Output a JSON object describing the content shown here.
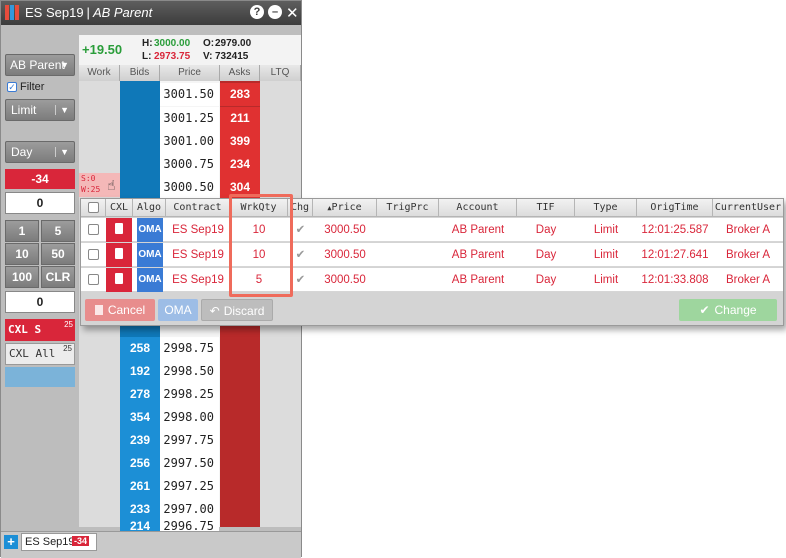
{
  "window": {
    "contract": "ES Sep19",
    "separator": "|",
    "account": "AB Parent"
  },
  "quote": {
    "change": "+19.50",
    "high_label": "H:",
    "high": "3000.00",
    "low_label": "L:",
    "low": "2973.75",
    "open_label": "O:",
    "open": "2979.00",
    "volume_label": "V:",
    "volume": "732415"
  },
  "ladder_headers": [
    "Work",
    "Bids",
    "Price",
    "Asks",
    "LTQ"
  ],
  "ladder_top": [
    {
      "price": "3001.50",
      "ask": "283"
    },
    {
      "price": "3001.25",
      "ask": "211"
    },
    {
      "price": "3001.00",
      "ask": "399"
    },
    {
      "price": "3000.75",
      "ask": "234"
    },
    {
      "price": "3000.50",
      "ask": "304"
    }
  ],
  "ladder_bottom": [
    {
      "bid": "258",
      "price": "2998.75"
    },
    {
      "bid": "192",
      "price": "2998.50"
    },
    {
      "bid": "278",
      "price": "2998.25"
    },
    {
      "bid": "354",
      "price": "2998.00"
    },
    {
      "bid": "239",
      "price": "2997.75"
    },
    {
      "bid": "256",
      "price": "2997.50"
    },
    {
      "bid": "261",
      "price": "2997.25"
    },
    {
      "bid": "233",
      "price": "2997.00"
    },
    {
      "bid": "214",
      "price": "2996.75"
    }
  ],
  "working_marker": {
    "s": "S:0",
    "w": "W:25"
  },
  "controls": {
    "account_select": "AB Parent",
    "filter_label": "Filter",
    "order_type": "Limit",
    "tif": "Day",
    "position": "-34",
    "quantity": "0",
    "qty_buttons": [
      "1",
      "5",
      "10",
      "50",
      "100",
      "CLR"
    ],
    "qty_field2": "0",
    "cxl_s_label": "CXL S",
    "cxl_s_count": "25",
    "cxl_all_label": "CXL All",
    "cxl_all_count": "25"
  },
  "popup": {
    "headers": [
      "CXL",
      "Algo",
      "Contract",
      "WrkQty",
      "Chg",
      "Price",
      "TrigPrc",
      "Account",
      "TIF",
      "Type",
      "OrigTime",
      "CurrentUser"
    ],
    "rows": [
      {
        "algo": "OMA",
        "contract": "ES Sep19",
        "wrkqty": "10",
        "price": "3000.50",
        "account": "AB Parent",
        "tif": "Day",
        "type": "Limit",
        "origtime": "12:01:25.587",
        "user": "Broker A"
      },
      {
        "algo": "OMA",
        "contract": "ES Sep19",
        "wrkqty": "10",
        "price": "3000.50",
        "account": "AB Parent",
        "tif": "Day",
        "type": "Limit",
        "origtime": "12:01:27.641",
        "user": "Broker A"
      },
      {
        "algo": "OMA",
        "contract": "ES Sep19",
        "wrkqty": "5",
        "price": "3000.50",
        "account": "AB Parent",
        "tif": "Day",
        "type": "Limit",
        "origtime": "12:01:33.808",
        "user": "Broker A"
      }
    ],
    "cancel_label": "Cancel",
    "oma_label": "OMA",
    "discard_label": "Discard",
    "change_label": "Change"
  },
  "tab": {
    "label": "ES Sep19",
    "position": "-34"
  },
  "colors": {
    "bid": "#1c8fd6",
    "ask": "#e03131",
    "order_text": "#d9263a",
    "highlight": "#ef6b5b"
  }
}
